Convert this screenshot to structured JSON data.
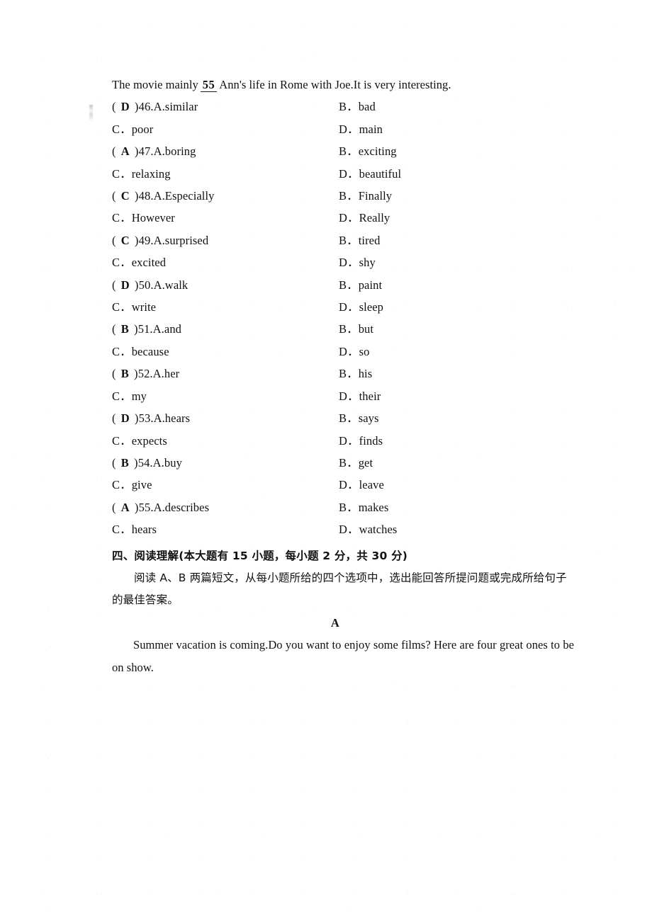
{
  "cloze": {
    "stem": {
      "before": "The movie mainly",
      "blank": "55",
      "after": "Ann's life in Rome with Joe.It is very interesting."
    },
    "questions": [
      {
        "answer": "D",
        "number": "46.",
        "a_label": "A.similar",
        "b_label": "B．bad",
        "c_label": "C．poor",
        "d_label": "D．main"
      },
      {
        "answer": "A",
        "number": "47.",
        "a_label": "A.boring",
        "b_label": "B．exciting",
        "c_label": "C．relaxing",
        "d_label": "D．beautiful"
      },
      {
        "answer": "C",
        "number": "48.",
        "a_label": "A.Especially",
        "b_label": "B．Finally",
        "c_label": "C．However",
        "d_label": "D．Really"
      },
      {
        "answer": "C",
        "number": "49.",
        "a_label": "A.surprised",
        "b_label": "B．tired",
        "c_label": "C．excited",
        "d_label": "D．shy"
      },
      {
        "answer": "D",
        "number": "50.",
        "a_label": "A.walk",
        "b_label": "B．paint",
        "c_label": "C．write",
        "d_label": "D．sleep"
      },
      {
        "answer": "B",
        "number": "51.",
        "a_label": "A.and",
        "b_label": "B．but",
        "c_label": "C．because",
        "d_label": "D．so"
      },
      {
        "answer": "B",
        "number": "52.",
        "a_label": "A.her",
        "b_label": "B．his",
        "c_label": "C．my",
        "d_label": "D．their"
      },
      {
        "answer": "D",
        "number": "53.",
        "a_label": "A.hears",
        "b_label": "B．says",
        "c_label": "C．expects",
        "d_label": "D．finds"
      },
      {
        "answer": "B",
        "number": "54.",
        "a_label": "A.buy",
        "b_label": "B．get",
        "c_label": "C．give",
        "d_label": "D．leave"
      },
      {
        "answer": "A",
        "number": "55.",
        "a_label": "A.describes",
        "b_label": "B．makes",
        "c_label": "C．hears",
        "d_label": "D．watches"
      }
    ],
    "paren_open": "(",
    "paren_close": ")"
  },
  "reading_section": {
    "heading": "四、阅读理解(本大题有 15 小题，每小题 2 分，共 30 分)",
    "instruction": "阅读 A、B 两篇短文，从每小题所给的四个选项中，选出能回答所提问题或完成所给句子的最佳答案。",
    "passage_label": "A",
    "passage_text": "Summer vacation is coming.Do you want to enjoy some films? Here are four great ones to be on show."
  }
}
